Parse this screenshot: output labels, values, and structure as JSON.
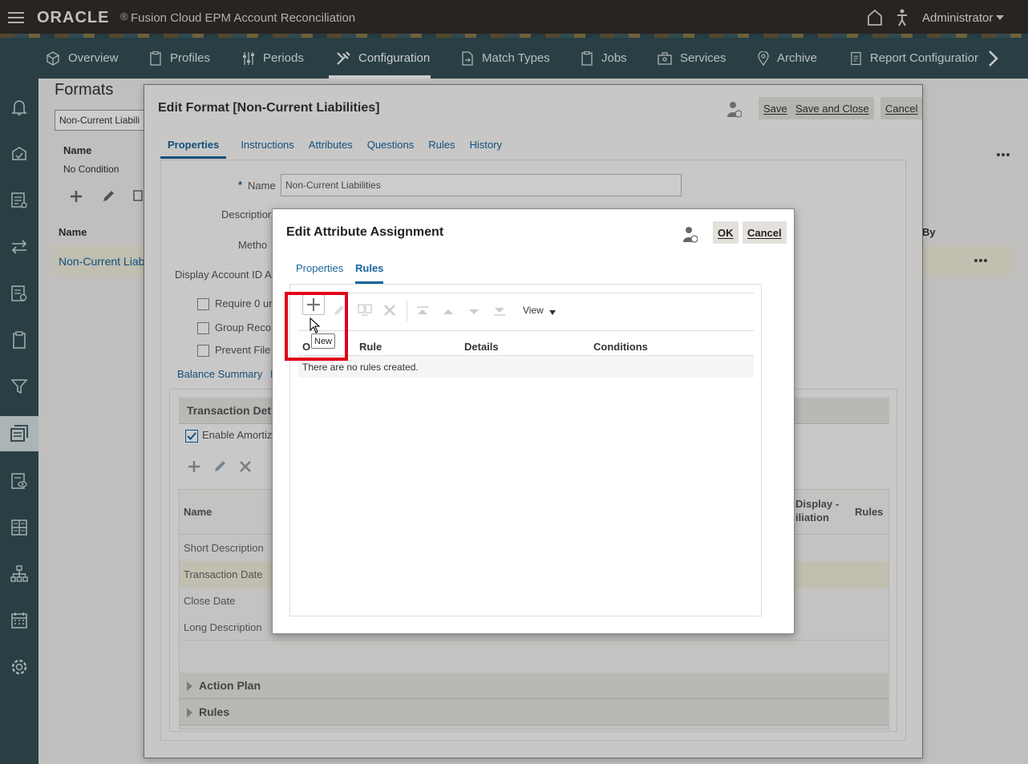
{
  "topbar": {
    "logo": "ORACLE",
    "logo_mark": "®",
    "app_title": "Fusion Cloud EPM Account Reconciliation",
    "user": "Administrator"
  },
  "nav": {
    "tabs": [
      {
        "label": "Overview",
        "icon": "cube-icon"
      },
      {
        "label": "Profiles",
        "icon": "clipboard-icon"
      },
      {
        "label": "Periods",
        "icon": "sliders-icon"
      },
      {
        "label": "Configuration",
        "icon": "tools-icon",
        "active": true
      },
      {
        "label": "Match Types",
        "icon": "document-arrow-icon"
      },
      {
        "label": "Jobs",
        "icon": "clipboard-icon"
      },
      {
        "label": "Services",
        "icon": "briefcase-icon"
      },
      {
        "label": "Archive",
        "icon": "pin-icon"
      },
      {
        "label": "Report Configuratior",
        "icon": "report-icon"
      }
    ]
  },
  "background": {
    "page_title": "Formats",
    "search_value": "Non-Current Liabili",
    "filter_header": "Name",
    "filter_value": "No Condition",
    "grid_header": "Name",
    "grid_by": "By",
    "row_link": "Non-Current Liab"
  },
  "panel": {
    "title": "Edit Format [Non-Current Liabilities]",
    "save": "Save",
    "save_close": "Save and Close",
    "cancel": "Cancel",
    "tabs": [
      "Properties",
      "Instructions",
      "Attributes",
      "Questions",
      "Rules",
      "History"
    ],
    "name_label": "Name",
    "name_value": "Non-Current Liabilities",
    "required_mark": "*",
    "description_label": "Descriptior",
    "method_label": "Metho",
    "display_label": "Display Account ID As",
    "check1": "Require 0 unc",
    "check2": "Group Recon",
    "check3": "Prevent File U",
    "subtab1": "Balance Summary",
    "subtab2": "I",
    "section_title": "Transaction Det",
    "enable_label": "Enable Amortiza",
    "col_name": "Name",
    "col_display": "Display -",
    "col_display2": "iliation",
    "col_rules": "Rules",
    "rows": [
      "Short Description",
      "Transaction Date",
      "Close Date",
      "Long Description"
    ],
    "action_plan": "Action Plan",
    "rules_section": "Rules"
  },
  "dialog": {
    "title": "Edit Attribute Assignment",
    "ok": "OK",
    "cancel": "Cancel",
    "tabs": [
      "Properties",
      "Rules"
    ],
    "view": "View",
    "columns": [
      "O",
      "Rule",
      "Details",
      "Conditions"
    ],
    "empty": "There are no rules created.",
    "tooltip": "New"
  }
}
